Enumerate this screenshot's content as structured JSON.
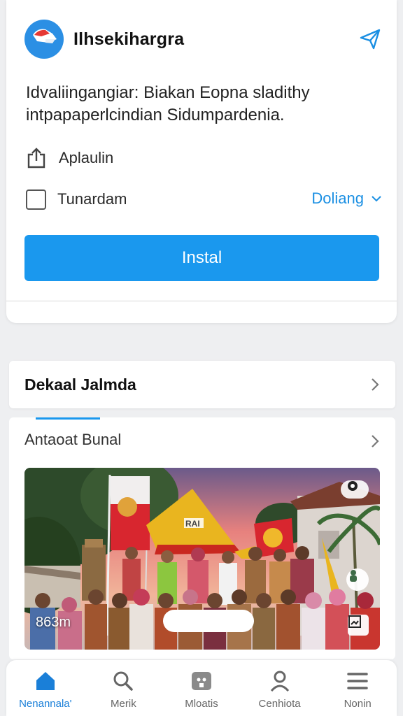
{
  "app": {
    "name": "Ilhsekihargra",
    "description": "Idvaliingangiar: Biakan Eopna sladithy intpapaperlcindian Sidumpardenia.",
    "share_icon": "send-icon",
    "accent_color": "#1a98ee"
  },
  "options": {
    "item1_label": "Aplaulin",
    "item1_icon": "share-icon",
    "item2_label": "Tunardam",
    "dropdown_label": "Doliang",
    "dropdown_icon": "chevron-down-icon"
  },
  "install_button_label": "Instal",
  "section": {
    "title": "Dekaal Jalmda"
  },
  "content": {
    "subtitle": "Antaoat Bunal",
    "photo_caption": "863m",
    "banner_text": "RAI"
  },
  "nav": [
    {
      "label": "Nenannala'",
      "icon": "home-icon",
      "active": true
    },
    {
      "label": "Merik",
      "icon": "search-icon",
      "active": false
    },
    {
      "label": "Mloatis",
      "icon": "apps-icon",
      "active": false
    },
    {
      "label": "Cenhiota",
      "icon": "profile-icon",
      "active": false
    },
    {
      "label": "Nonin",
      "icon": "menu-icon",
      "active": false
    }
  ]
}
